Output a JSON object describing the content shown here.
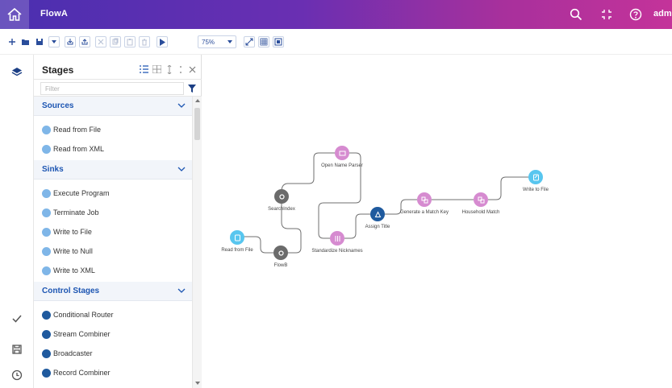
{
  "app": {
    "title": "FlowA",
    "user": "admi"
  },
  "toolbar": {
    "zoom": "75%"
  },
  "panel": {
    "title": "Stages",
    "filter_placeholder": "Filter",
    "sections": [
      {
        "label": "Sources",
        "items": [
          "Read from File",
          "Read from XML"
        ]
      },
      {
        "label": "Sinks",
        "items": [
          "Execute Program",
          "Terminate Job",
          "Write to File",
          "Write to Null",
          "Write to XML"
        ]
      },
      {
        "label": "Control Stages",
        "items": [
          "Conditional Router",
          "Stream Combiner",
          "Broadcaster",
          "Record Combiner"
        ]
      }
    ]
  },
  "canvas": {
    "nodes": {
      "read_from_file": "Read from File",
      "flow_b": "FlowB",
      "search_index": "SearchIndex",
      "open_name_parser": "Open Name Parser",
      "standardize_nicknames": "Standardize Nicknames",
      "assign_title": "Assign Title",
      "generate_match_key": "Generate a Match Key",
      "household_match": "Household Match",
      "write_to_file": "Write to File"
    }
  },
  "colors": {
    "title_gradient_start": "#4a2fb0",
    "title_gradient_end": "#c4339a",
    "section_blue": "#1c55b2",
    "node_pink": "#d68bd0",
    "node_gray": "#6b6b6b",
    "node_cyan": "#58c6ef",
    "node_navy": "#1f5a9e"
  }
}
